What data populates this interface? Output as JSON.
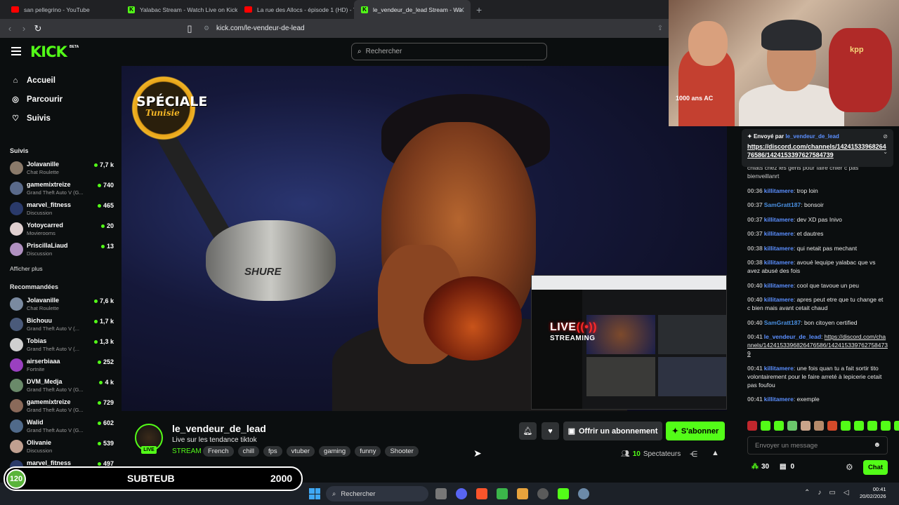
{
  "browser": {
    "tabs": [
      {
        "title": "san pellegrino - YouTube",
        "icon": "youtube-icon",
        "active": false
      },
      {
        "title": "Yalabac Stream - Watch Live on Kick",
        "icon": "kick-icon",
        "active": false
      },
      {
        "title": "La rue des Allocs - épisode 1 (HD) - Y",
        "icon": "youtube-icon",
        "active": false
      },
      {
        "title": "le_vendeur_de_lead Stream - Wa",
        "icon": "kick-icon",
        "active": true
      }
    ],
    "url": "kick.com/le-vendeur-de-lead"
  },
  "kick": {
    "logo": "KICK",
    "beta": "BETA",
    "search_placeholder": "Rechercher"
  },
  "sidebar": {
    "nav": [
      {
        "label": "Accueil",
        "icon": "home-icon"
      },
      {
        "label": "Parcourir",
        "icon": "compass-icon"
      },
      {
        "label": "Suivis",
        "icon": "heart-icon"
      }
    ],
    "followed_heading": "Suivis",
    "followed": [
      {
        "name": "Jolavanille",
        "category": "Chat Roulette",
        "viewers": "7,7 k"
      },
      {
        "name": "gamemixtreize",
        "category": "Grand Theft Auto V (G...",
        "viewers": "740"
      },
      {
        "name": "marvel_fitness",
        "category": "Discussion",
        "viewers": "465"
      },
      {
        "name": "Yotoycarred",
        "category": "Movierooms",
        "viewers": "20"
      },
      {
        "name": "PriscillaLiaud",
        "category": "Discussion",
        "viewers": "13"
      }
    ],
    "show_more": "Afficher plus",
    "recommended_heading": "Recommandées",
    "recommended": [
      {
        "name": "Jolavanille",
        "category": "Chat Roulette",
        "viewers": "7,6 k"
      },
      {
        "name": "Bichouu",
        "category": "Grand Theft Auto V (...",
        "viewers": "1,7 k"
      },
      {
        "name": "Tobias",
        "category": "Grand Theft Auto V (...",
        "viewers": "1,3 k"
      },
      {
        "name": "airserbiaaa",
        "category": "Fortnite",
        "viewers": "252"
      },
      {
        "name": "DVM_Medja",
        "category": "Grand Theft Auto V (G...",
        "viewers": "4 k"
      },
      {
        "name": "gamemixtreize",
        "category": "Grand Theft Auto V (G...",
        "viewers": "729"
      },
      {
        "name": "Walid",
        "category": "Grand Theft Auto V (G...",
        "viewers": "602"
      },
      {
        "name": "Olivanie",
        "category": "Discussion",
        "viewers": "539"
      },
      {
        "name": "marvel_fitness",
        "category": "Discussion",
        "viewers": "497"
      }
    ]
  },
  "video": {
    "badge_line1": "SPÉCIALE",
    "badge_line2": "Tunisie",
    "mic_brand": "SHURE",
    "live_word": "LIVE",
    "live_waves": "((•))",
    "streaming": "STREAMING",
    "webcam_shirt_text": "1000 ans AC",
    "webcam_book_text": "kpp"
  },
  "stream": {
    "streamer": "le_vendeur_de_lead",
    "live_badge": "LIVE",
    "title": "Live sur les tendance tiktok",
    "category": "STREAM",
    "tags": [
      "French",
      "chill",
      "fps",
      "vtuber",
      "gaming",
      "funny",
      "Shooter"
    ],
    "gift_label": "Offrir un abonnement",
    "subscribe_label": "S'abonner",
    "viewer_count": "10",
    "viewer_label": "Spectateurs"
  },
  "chat": {
    "pinned_prefix": "Envoyé par",
    "pinned_user": "le_vendeur_de_lead",
    "pinned_link": "https://discord.com/channels/1424153396826476586/1424153397627584739",
    "partial_message": "chiats chez les gens pour faire chier c pas bienveillanrt",
    "messages": [
      {
        "time": "00:36",
        "user": "killitamere",
        "color": "#5b8fff",
        "text": "trop loin"
      },
      {
        "time": "00:37",
        "user": "SamGratt187",
        "color": "#4a90e2",
        "text": "bonsoir"
      },
      {
        "time": "00:37",
        "user": "killitamere",
        "color": "#5b8fff",
        "text": "dev XD pas Inivo"
      },
      {
        "time": "00:37",
        "user": "killitamere",
        "color": "#5b8fff",
        "text": "et dautres"
      },
      {
        "time": "00:38",
        "user": "killitamere",
        "color": "#5b8fff",
        "text": "qui netait pas mechant"
      },
      {
        "time": "00:38",
        "user": "killitamere",
        "color": "#5b8fff",
        "text": "avoué lequipe yalabac que vs avez abusé des fois"
      },
      {
        "time": "00:40",
        "user": "killitamere",
        "color": "#5b8fff",
        "text": "cool que tavoue un peu"
      },
      {
        "time": "00:40",
        "user": "killitamere",
        "color": "#5b8fff",
        "text": "apres peut etre que tu change et c bien mais avant cetait chaud"
      },
      {
        "time": "00:40",
        "user": "SamGratt187",
        "color": "#4a90e2",
        "text": "bon citoyen certified"
      },
      {
        "time": "00:41",
        "user": "le_vendeur_de_lead",
        "color": "#5b8fff",
        "text": "",
        "link": "https://discord.com/channels/1424153396826476586/1424153397627584739"
      },
      {
        "time": "00:41",
        "user": "killitamere",
        "color": "#5b8fff",
        "text": "une fois quan tu a fait sortir tito volontairement pour le faire arreté à lepicerie cetait pas foufou"
      },
      {
        "time": "00:41",
        "user": "killitamere",
        "color": "#5b8fff",
        "text": "exemple"
      }
    ],
    "input_placeholder": "Envoyer un message",
    "points": "30",
    "gifts": "0",
    "send_label": "Chat"
  },
  "goal": {
    "current": "120",
    "label": "SUBTEUB",
    "target": "2000"
  },
  "taskbar": {
    "search_label": "Rechercher",
    "time": "00:41",
    "date": "20/02/2026"
  }
}
